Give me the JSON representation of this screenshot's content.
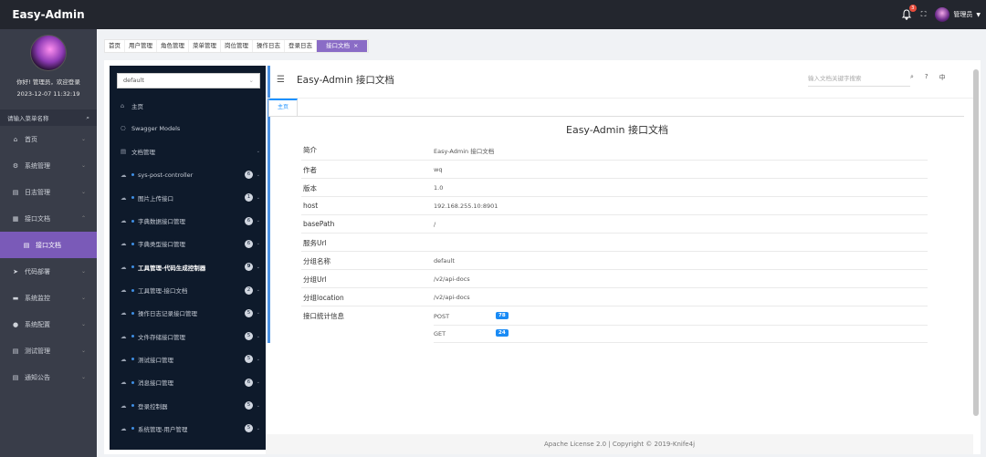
{
  "app": {
    "title": "Easy-Admin"
  },
  "header": {
    "notification_count": "3",
    "user_name": "管理员"
  },
  "profile": {
    "welcome": "你好! 管理员，欢迎登录",
    "datetime": "2023-12-07 11:32:19"
  },
  "sidebar": {
    "search_placeholder": "请输入菜单名称",
    "items": [
      {
        "label": "首页",
        "icon": "home-icon"
      },
      {
        "label": "系统管理",
        "icon": "gear-icon"
      },
      {
        "label": "日志管理",
        "icon": "file-icon"
      },
      {
        "label": "接口文档",
        "icon": "doc-icon"
      },
      {
        "label": "接口文档",
        "icon": "doc-icon"
      },
      {
        "label": "代码部署",
        "icon": "send-icon"
      },
      {
        "label": "系统监控",
        "icon": "monitor-icon"
      },
      {
        "label": "系统配置",
        "icon": "config-icon"
      },
      {
        "label": "测试管理",
        "icon": "list-icon"
      },
      {
        "label": "通知公告",
        "icon": "notice-icon"
      }
    ]
  },
  "tabs": [
    "首页",
    "用户管理",
    "角色管理",
    "菜单管理",
    "岗位管理",
    "操作日志",
    "登录日志",
    "接口文档"
  ],
  "knife4j": {
    "group_select": "default",
    "header_title": "Easy-Admin 接口文档",
    "search_placeholder": "输入文档关键字搜索",
    "lang": "中",
    "nav": [
      {
        "label": "主页"
      },
      {
        "label": "Swagger Models"
      },
      {
        "label": "文档管理"
      },
      {
        "label": "sys-post-controller",
        "count": "6"
      },
      {
        "label": "图片上传接口",
        "count": "1"
      },
      {
        "label": "字典数据接口管理",
        "count": "6"
      },
      {
        "label": "字典类型接口管理",
        "count": "6"
      },
      {
        "label": "工具管理-代码生成控制器",
        "count": "9"
      },
      {
        "label": "工具管理-接口文档",
        "count": "2"
      },
      {
        "label": "操作日志记录接口管理",
        "count": "5"
      },
      {
        "label": "文件存储接口管理",
        "count": "5"
      },
      {
        "label": "测试接口管理",
        "count": "5"
      },
      {
        "label": "消息接口管理",
        "count": "6"
      },
      {
        "label": "登录控制器",
        "count": "5"
      },
      {
        "label": "系统管理-用户管理",
        "count": "5"
      }
    ],
    "main_tab": "主页",
    "doc_title": "Easy-Admin 接口文档",
    "info": [
      {
        "label": "简介",
        "value": "Easy-Admin 接口文档"
      },
      {
        "label": "作者",
        "value": "wq"
      },
      {
        "label": "版本",
        "value": "1.0"
      },
      {
        "label": "host",
        "value": "192.168.255.10:8901"
      },
      {
        "label": "basePath",
        "value": "/"
      },
      {
        "label": "服务Url",
        "value": ""
      },
      {
        "label": "分组名称",
        "value": "default"
      },
      {
        "label": "分组Url",
        "value": "/v2/api-docs"
      },
      {
        "label": "分组location",
        "value": "/v2/api-docs"
      },
      {
        "label": "接口统计信息",
        "value": ""
      }
    ],
    "stats": [
      {
        "method": "POST",
        "count": "78"
      },
      {
        "method": "GET",
        "count": "24"
      }
    ],
    "footer": "Apache License 2.0 | Copyright © 2019-Knife4j"
  }
}
